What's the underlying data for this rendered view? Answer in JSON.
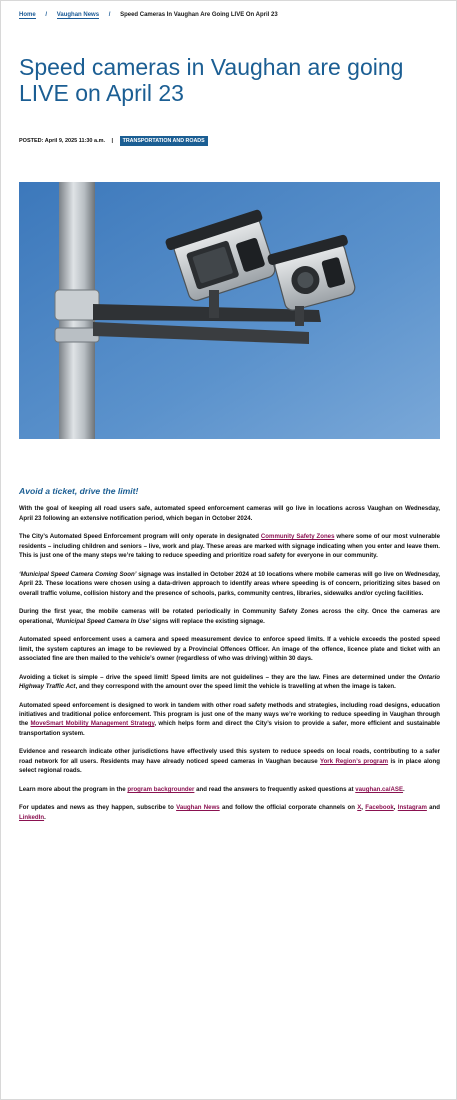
{
  "breadcrumb": {
    "home": "Home",
    "sep": "/",
    "news": "Vaughan News",
    "current": "Speed Cameras In Vaughan Are Going LIVE On April 23"
  },
  "article": {
    "title": "Speed cameras in Vaughan are going LIVE on April 23",
    "posted_label": "POSTED:",
    "posted_date": "April 9, 2025 11:30 a.m.",
    "posted_sep": "|",
    "category": "TRANSPORTATION AND ROADS"
  },
  "body": {
    "heading": "Avoid a ticket, drive the limit!",
    "p1": "With the goal of keeping all road users safe, automated speed enforcement cameras will go live in locations across Vaughan on Wednesday, April 23 following an extensive notification period, which began in October 2024.",
    "p2_a": "The City’s Automated Speed Enforcement program will only operate in designated ",
    "p2_link": "Community Safety Zones",
    "p2_b": " where some of our most vulnerable residents – including children and seniors – live, work and play. These areas are marked with signage indicating when you enter and leave them. This is just one of the many steps we’re taking to reduce speeding and prioritize road safety for everyone in our community.",
    "p3_em": "‘Municipal Speed Camera Coming Soon’",
    "p3_b": " signage was installed in October 2024 at 10 locations where mobile cameras will go live on Wednesday, April 23. These locations were chosen using a data-driven approach to identify areas where speeding is of concern, prioritizing sites based on overall traffic volume, collision history and the presence of schools, parks, community centres, libraries, sidewalks and/or cycling facilities.",
    "p4_a": "During the first year, the mobile cameras will be rotated periodically in Community Safety Zones across the city. Once the cameras are operational, ",
    "p4_em": "‘Municipal Speed Camera In Use’",
    "p4_b": " signs will replace the existing signage.",
    "p5": "Automated speed enforcement uses a camera and speed measurement device to enforce speed limits. If a vehicle exceeds the posted speed limit, the system captures an image to be reviewed by a Provincial Offences Officer. An image of the offence, licence plate and ticket with an associated fine are then mailed to the vehicle’s owner (regardless of who was driving) within 30 days.",
    "p6_strong": "Avoiding a ticket is simple – drive the speed limit!",
    "p6_a": " Speed limits are not guidelines – they are the law. Fines are determined under the ",
    "p6_em": "Ontario Highway Traffic Act",
    "p6_b": ", and they correspond with the amount over the speed limit the vehicle is travelling at when the image is taken.",
    "p7_a": "Automated speed enforcement is designed to work in tandem with other road safety methods and strategies, including road designs, education initiatives and traditional police enforcement. This program is just one of the many ways we’re working to reduce speeding in Vaughan through the ",
    "p7_link": "MoveSmart Mobility Management Strategy",
    "p7_b": ", which helps form and direct the City’s vision to provide a safer, more efficient and sustainable transportation system.",
    "p8_a": "Evidence and research indicate other jurisdictions have effectively used this system to reduce speeds on local roads, contributing to a safer road network for all users. Residents may have already noticed speed cameras in Vaughan because ",
    "p8_link": "York Region’s program",
    "p8_b": " is in place along select regional roads.",
    "p9_a": "Learn more about the program in the ",
    "p9_link1": "program backgrounder",
    "p9_b": " and read the answers to frequently asked questions at ",
    "p9_link2": "vaughan.ca/ASE",
    "p9_c": ".",
    "p10_a": "For updates and news as they happen, subscribe to ",
    "p10_link1": "Vaughan News",
    "p10_b": " and follow the official corporate channels on ",
    "p10_x": "X",
    "p10_comma1": ", ",
    "p10_fb": "Facebook",
    "p10_comma2": ", ",
    "p10_ig": "Instagram",
    "p10_and": " and ",
    "p10_li": "LinkedIn",
    "p10_end": "."
  },
  "colors": {
    "brand_blue": "#1b5e93",
    "link_maroon": "#8a1150",
    "sky": "#4f86c2"
  },
  "hero_image": {
    "icon": "speed-camera-photo"
  }
}
